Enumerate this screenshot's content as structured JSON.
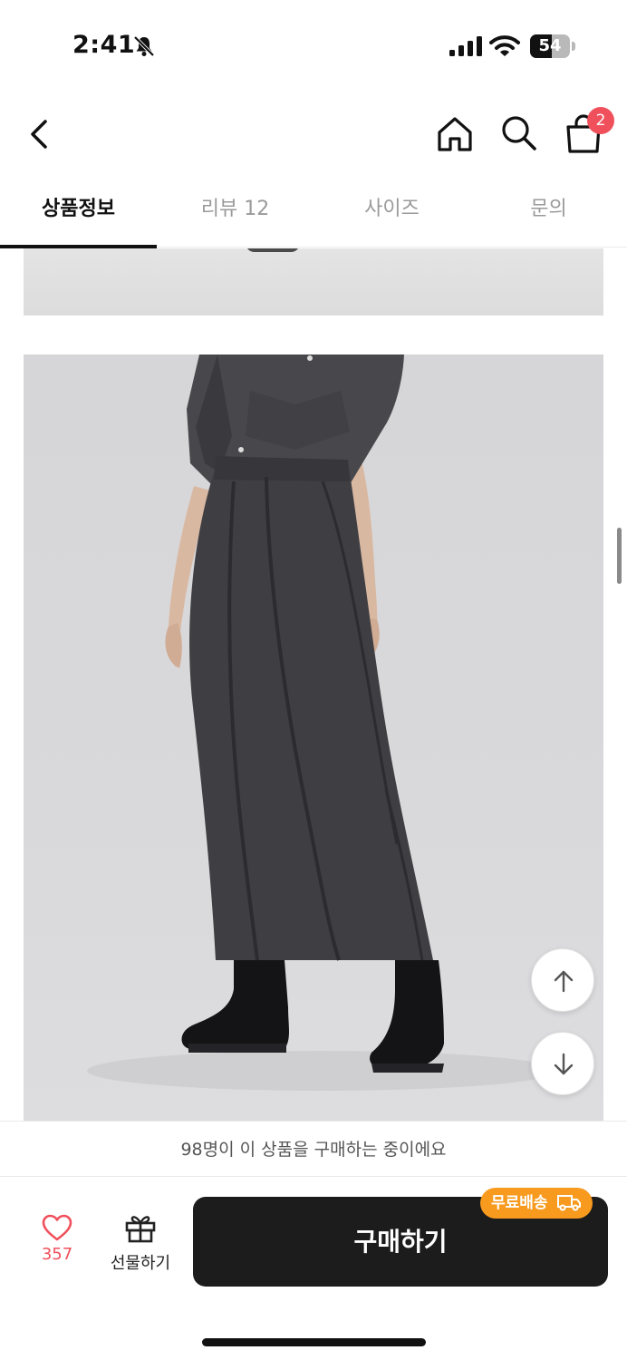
{
  "status_bar": {
    "time": "2:41",
    "battery_level": "54",
    "icons": [
      "bell-off-icon",
      "signal-icon",
      "wifi-icon",
      "battery-icon"
    ]
  },
  "header": {
    "icons": [
      "back-icon",
      "home-icon",
      "search-icon",
      "cart-icon"
    ],
    "cart_count": "2"
  },
  "tabs": [
    {
      "label": "상품정보",
      "active": true
    },
    {
      "label": "리뷰 12",
      "active": false
    },
    {
      "label": "사이즈",
      "active": false
    },
    {
      "label": "문의",
      "active": false
    }
  ],
  "content": {
    "images": [
      "product-photo-top-partial",
      "product-photo-skirt-outfit"
    ]
  },
  "floating_buttons": [
    "scroll-up-icon",
    "scroll-down-icon"
  ],
  "notice": {
    "text": "98명이 이 상품을 구매하는 중이에요"
  },
  "bottom_bar": {
    "like_count": "357",
    "gift_label": "선물하기",
    "buy_label": "구매하기",
    "free_shipping_label": "무료배송"
  },
  "colors": {
    "accent_red": "#f0505c",
    "free_shipping_orange": "#f79a1e",
    "buy_button": "#1c1c1c"
  }
}
